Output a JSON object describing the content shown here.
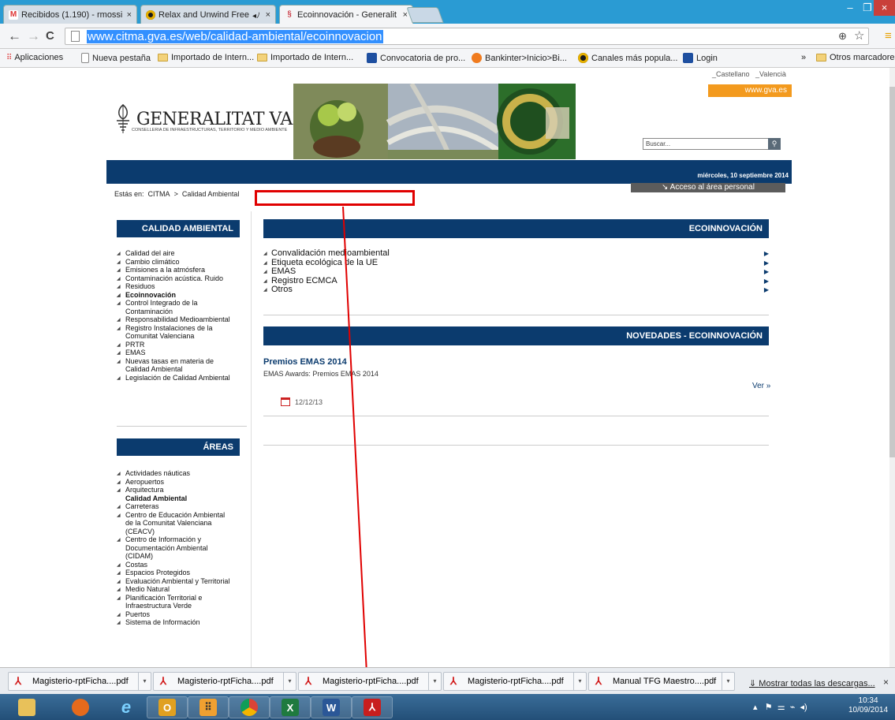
{
  "browser": {
    "tabs": [
      {
        "title": "Recibidos (1.190) - rmossi",
        "icon": "gmail-icon"
      },
      {
        "title": "Relax and Unwind Free",
        "icon": "music-icon"
      },
      {
        "title": "Ecoinnovación - Generalit",
        "icon": "gva-icon"
      }
    ],
    "url": "www.citma.gva.es/web/calidad-ambiental/ecoinnovacion",
    "bookmarks": [
      "Aplicaciones",
      "Nueva pestaña",
      "Importado de Intern...",
      "Importado de Intern...",
      "Convocatoria de pro...",
      "Bankinter>Inicio>Bi...",
      "Canales más popula...",
      "Login"
    ],
    "more_bookmarks": "»",
    "other_bookmarks": "Otros marcadores"
  },
  "page": {
    "lang_castellano": "_Castellano",
    "lang_valencia": "_Valencià",
    "gva_link": "www.gva.es",
    "logo_title": "GENERALITAT VALENCIANA",
    "logo_subtitle": "CONSELLERIA DE INFRAESTRUCTURAS, TERRITORIO Y MEDIO AMBIENTE",
    "search_placeholder": "Buscar...",
    "date": "miércoles, 10 septiembre 2014",
    "acceso": "Acceso al área personal",
    "breadcrumb_prefix": "Estás en:",
    "breadcrumb_1": "CITMA",
    "breadcrumb_sep": ">",
    "breadcrumb_2": "Calidad Ambiental",
    "side1": {
      "title": "CALIDAD AMBIENTAL",
      "items": [
        "Calidad del aire",
        "Cambio climático",
        "Emisiones a la atmósfera",
        "Contaminación acústica. Ruido",
        "Residuos",
        "Ecoinnovación",
        "Control Integrado de la",
        "Contaminación",
        "Responsabilidad Medioambiental",
        "Registro Instalaciones de la",
        "Comunitat Valenciana",
        "PRTR",
        "EMAS",
        "Nuevas tasas en materia de",
        "Calidad Ambiental",
        "Legislación de Calidad Ambiental"
      ]
    },
    "side2": {
      "title": "ÁREAS",
      "items": [
        "Actividades náuticas",
        "Aeropuertos",
        "Arquitectura",
        "Calidad Ambiental",
        "Carreteras",
        "Centro de Educación Ambiental",
        "de la Comunitat Valenciana",
        "(CEACV)",
        "Centro de Información y",
        "Documentación Ambiental",
        "(CIDAM)",
        "Costas",
        "Espacios Protegidos",
        "Evaluación Ambiental y Territorial",
        "Medio Natural",
        "Planificación Territorial e",
        "Infraestructura Verde",
        "Puertos",
        "Sistema de Información"
      ]
    },
    "main": {
      "title": "ECOINNOVACIÓN",
      "items": [
        "Convalidación medioambiental",
        "Etiqueta ecológica de la UE",
        "EMAS",
        "Registro ECMCA",
        "Otros"
      ],
      "news_title": "NOVEDADES - ECOINNOVACIÓN",
      "news_headline": "Premios EMAS 2014",
      "news_subtitle": "EMAS Awards: Premios EMAS 2014",
      "news_more": "Ver »",
      "news_date": "12/12/13"
    }
  },
  "downloads": {
    "items": [
      "Magisterio-rptFicha....pdf",
      "Magisterio-rptFicha....pdf",
      "Magisterio-rptFicha....pdf",
      "Magisterio-rptFicha....pdf",
      "Manual TFG Maestro....pdf"
    ],
    "show_all": "Mostrar todas las descargas...",
    "close": "×"
  },
  "taskbar": {
    "time": "10:34",
    "date": "10/09/2014"
  },
  "colors": {
    "accent_blue": "#0b3b6e",
    "orange": "#f39a1e",
    "highlight_red": "#e00000"
  }
}
